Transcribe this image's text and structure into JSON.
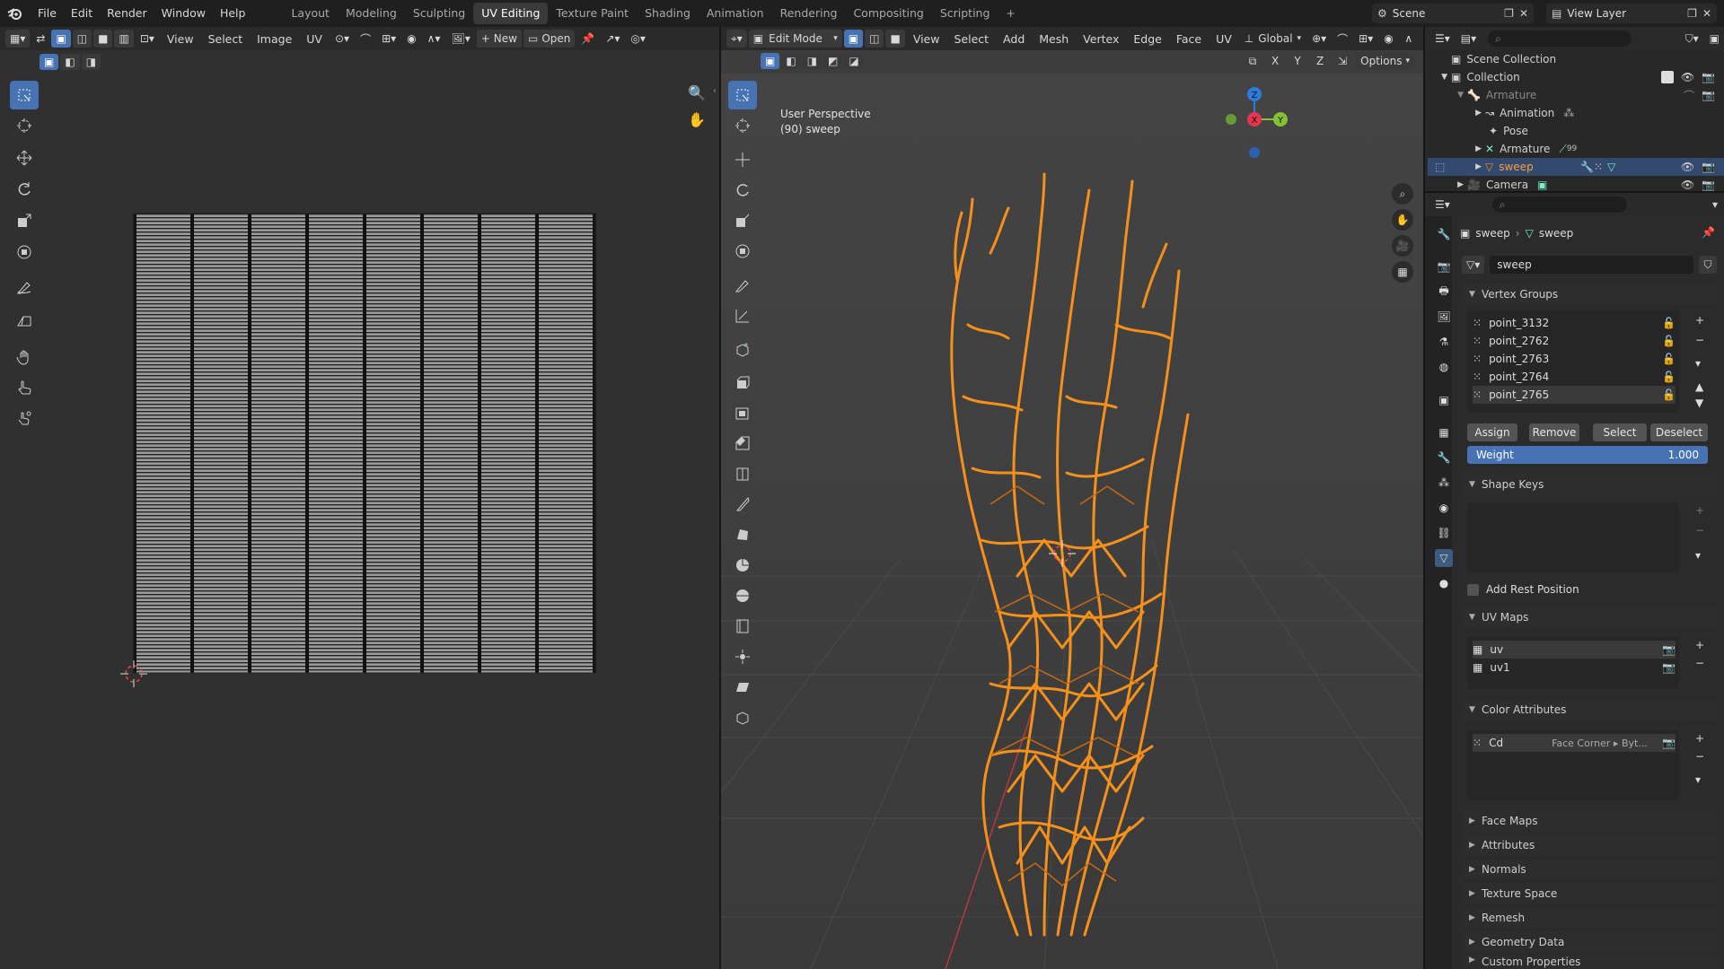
{
  "topbar": {
    "menus": [
      "File",
      "Edit",
      "Render",
      "Window",
      "Help"
    ],
    "workspaces": [
      "Layout",
      "Modeling",
      "Sculpting",
      "UV Editing",
      "Texture Paint",
      "Shading",
      "Animation",
      "Rendering",
      "Compositing",
      "Scripting"
    ],
    "active_workspace": "UV Editing",
    "add_workspace": "+",
    "scene": "Scene",
    "view_layer": "View Layer"
  },
  "uv_editor": {
    "menus": [
      "View",
      "Select",
      "Image",
      "UV"
    ],
    "new_label": "New",
    "open_label": "Open"
  },
  "viewport": {
    "mode": "Edit Mode",
    "menus": [
      "View",
      "Select",
      "Add",
      "Mesh",
      "Vertex",
      "Edge",
      "Face",
      "UV"
    ],
    "orientation": "Global",
    "axes": [
      "X",
      "Y",
      "Z"
    ],
    "options_label": "Options",
    "overlay_line1": "User Perspective",
    "overlay_line2": "(90) sweep",
    "gizmo": {
      "x": "X",
      "y": "Y",
      "z": "Z"
    },
    "mesh_color": "#f5901a"
  },
  "outliner": {
    "scene_collection": "Scene Collection",
    "collection": "Collection",
    "items": [
      {
        "label": "Armature"
      },
      {
        "label": "Animation"
      },
      {
        "label": "Pose"
      },
      {
        "label": "Armature",
        "badge": "99"
      },
      {
        "label": "sweep"
      },
      {
        "label": "Camera"
      }
    ]
  },
  "properties": {
    "breadcrumb": [
      "sweep",
      "sweep"
    ],
    "mesh_name": "sweep",
    "vertex_groups_title": "Vertex Groups",
    "vertex_groups": [
      "point_3132",
      "point_2762",
      "point_2763",
      "point_2764",
      "point_2765"
    ],
    "assign": "Assign",
    "remove": "Remove",
    "select": "Select",
    "deselect": "Deselect",
    "weight_label": "Weight",
    "weight_value": "1.000",
    "shape_keys_title": "Shape Keys",
    "add_rest_position": "Add Rest Position",
    "uv_maps_title": "UV Maps",
    "uv_maps": [
      "uv",
      "uv1"
    ],
    "color_attributes_title": "Color Attributes",
    "color_attr_name": "Cd",
    "color_attr_domain": "Face Corner ▸ Byt...",
    "collapsed_sections": [
      "Face Maps",
      "Attributes",
      "Normals",
      "Texture Space",
      "Remesh",
      "Geometry Data",
      "Custom Properties"
    ]
  },
  "colors": {
    "accent": "#4772b3",
    "orange": "#f5901a",
    "x_axis": "#e8344e",
    "y_axis": "#86c034",
    "z_axis": "#2e7be0"
  }
}
